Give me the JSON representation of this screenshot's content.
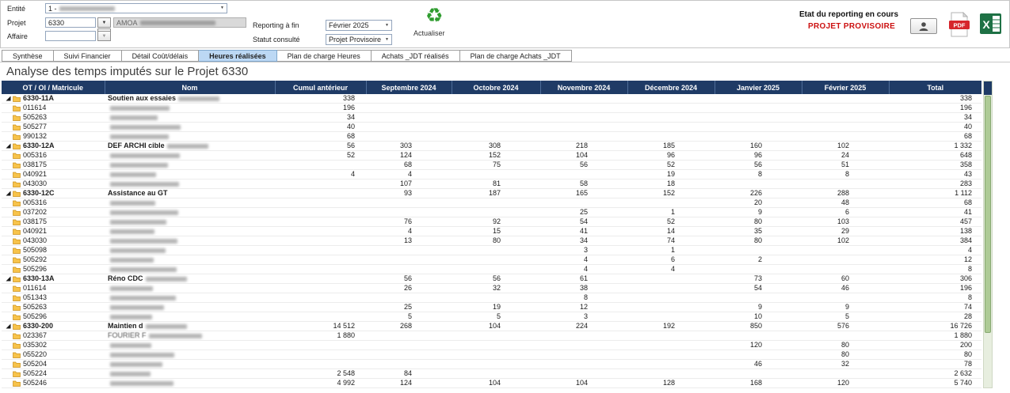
{
  "glyphs": {
    "caret": "▼",
    "dots": "…",
    "recycle": "♻"
  },
  "icons": {
    "refresh": "recycle-arrows",
    "user": "person-silhouette",
    "pdf": "pdf-file",
    "excel": "excel-file",
    "folder": "folder",
    "expand": "expanded-node-triangle",
    "caret": "dropdown-caret"
  },
  "toolbar": {
    "entite_label": "Entité",
    "entite_value": "1 -",
    "projet_label": "Projet",
    "projet_value": "6330",
    "projet_desc_prefix": "AMOA",
    "affaire_label": "Affaire",
    "affaire_value": "",
    "reporting_label": "Reporting à fin",
    "reporting_value": "Février 2025",
    "statut_label": "Statut consulté",
    "statut_value": "Projet Provisoire",
    "refresh_label": "Actualiser",
    "status_heading": "Etat du reporting en cours",
    "status_value": "PROJET PROVISOIRE"
  },
  "tabs": [
    {
      "label": "Synthèse",
      "active": false
    },
    {
      "label": "Suivi Financier",
      "active": false
    },
    {
      "label": "Détail Coût/délais",
      "active": false
    },
    {
      "label": "Heures réalisées",
      "active": true
    },
    {
      "label": "Plan de charge Heures",
      "active": false
    },
    {
      "label": "Achats _JDT réalisés",
      "active": false
    },
    {
      "label": "Plan de charge Achats _JDT",
      "active": false
    }
  ],
  "page_title": "Analyse des temps imputés sur le Projet 6330",
  "table": {
    "columns": [
      "OT / OI / Matricule",
      "Nom",
      "Cumul antérieur",
      "Septembre 2024",
      "Octobre 2024",
      "Novembre 2024",
      "Décembre 2024",
      "Janvier 2025",
      "Février 2025",
      "Total"
    ],
    "rows": [
      {
        "group": true,
        "code": "6330-11A",
        "name": "Soutien aux essaies",
        "redacted": true,
        "v": [
          "338",
          "",
          "",
          "",
          "",
          "",
          "",
          "338"
        ]
      },
      {
        "group": false,
        "code": "011614",
        "name": "",
        "redacted": true,
        "v": [
          "196",
          "",
          "",
          "",
          "",
          "",
          "",
          "196"
        ]
      },
      {
        "group": false,
        "code": "505263",
        "name": "",
        "redacted": true,
        "v": [
          "34",
          "",
          "",
          "",
          "",
          "",
          "",
          "34"
        ]
      },
      {
        "group": false,
        "code": "505277",
        "name": "",
        "redacted": true,
        "v": [
          "40",
          "",
          "",
          "",
          "",
          "",
          "",
          "40"
        ]
      },
      {
        "group": false,
        "code": "990132",
        "name": "",
        "redacted": true,
        "v": [
          "68",
          "",
          "",
          "",
          "",
          "",
          "",
          "68"
        ]
      },
      {
        "group": true,
        "code": "6330-12A",
        "name": "DEF ARCHI cible",
        "redacted": true,
        "v": [
          "56",
          "303",
          "308",
          "218",
          "185",
          "160",
          "102",
          "1 332"
        ]
      },
      {
        "group": false,
        "code": "005316",
        "name": "",
        "redacted": true,
        "v": [
          "52",
          "124",
          "152",
          "104",
          "96",
          "96",
          "24",
          "648"
        ]
      },
      {
        "group": false,
        "code": "038175",
        "name": "",
        "redacted": true,
        "v": [
          "",
          "68",
          "75",
          "56",
          "52",
          "56",
          "51",
          "358"
        ]
      },
      {
        "group": false,
        "code": "040921",
        "name": "",
        "redacted": true,
        "v": [
          "4",
          "4",
          "",
          "",
          "19",
          "8",
          "8",
          "43"
        ]
      },
      {
        "group": false,
        "code": "043030",
        "name": "",
        "redacted": true,
        "v": [
          "",
          "107",
          "81",
          "58",
          "18",
          "",
          "",
          "283"
        ]
      },
      {
        "group": true,
        "code": "6330-12C",
        "name": "Assistance au GT",
        "redacted": false,
        "v": [
          "",
          "93",
          "187",
          "165",
          "152",
          "226",
          "288",
          "1 112"
        ]
      },
      {
        "group": false,
        "code": "005316",
        "name": "",
        "redacted": true,
        "v": [
          "",
          "",
          "",
          "",
          "",
          "20",
          "48",
          "68"
        ]
      },
      {
        "group": false,
        "code": "037202",
        "name": "",
        "redacted": true,
        "v": [
          "",
          "",
          "",
          "25",
          "1",
          "9",
          "6",
          "41"
        ]
      },
      {
        "group": false,
        "code": "038175",
        "name": "",
        "redacted": true,
        "v": [
          "",
          "76",
          "92",
          "54",
          "52",
          "80",
          "103",
          "457"
        ]
      },
      {
        "group": false,
        "code": "040921",
        "name": "",
        "redacted": true,
        "v": [
          "",
          "4",
          "15",
          "41",
          "14",
          "35",
          "29",
          "138"
        ]
      },
      {
        "group": false,
        "code": "043030",
        "name": "",
        "redacted": true,
        "v": [
          "",
          "13",
          "80",
          "34",
          "74",
          "80",
          "102",
          "384"
        ]
      },
      {
        "group": false,
        "code": "505098",
        "name": "",
        "redacted": true,
        "v": [
          "",
          "",
          "",
          "3",
          "1",
          "",
          "",
          "4"
        ]
      },
      {
        "group": false,
        "code": "505292",
        "name": "",
        "redacted": true,
        "v": [
          "",
          "",
          "",
          "4",
          "6",
          "2",
          "",
          "12"
        ]
      },
      {
        "group": false,
        "code": "505296",
        "name": "",
        "redacted": true,
        "v": [
          "",
          "",
          "",
          "4",
          "4",
          "",
          "",
          "8"
        ]
      },
      {
        "group": true,
        "code": "6330-13A",
        "name": "Réno CDC",
        "redacted": true,
        "v": [
          "",
          "56",
          "56",
          "61",
          "",
          "73",
          "60",
          "306"
        ]
      },
      {
        "group": false,
        "code": "011614",
        "name": "",
        "redacted": true,
        "v": [
          "",
          "26",
          "32",
          "38",
          "",
          "54",
          "46",
          "196"
        ]
      },
      {
        "group": false,
        "code": "051343",
        "name": "",
        "redacted": true,
        "v": [
          "",
          "",
          "",
          "8",
          "",
          "",
          "",
          "8"
        ]
      },
      {
        "group": false,
        "code": "505263",
        "name": "",
        "redacted": true,
        "v": [
          "",
          "25",
          "19",
          "12",
          "",
          "9",
          "9",
          "74"
        ]
      },
      {
        "group": false,
        "code": "505296",
        "name": "",
        "redacted": true,
        "v": [
          "",
          "5",
          "5",
          "3",
          "",
          "10",
          "5",
          "28"
        ]
      },
      {
        "group": true,
        "code": "6330-200",
        "name": "Maintien d",
        "redacted": true,
        "v": [
          "14 512",
          "268",
          "104",
          "224",
          "192",
          "850",
          "576",
          "16 726"
        ]
      },
      {
        "group": false,
        "code": "023367",
        "name": "FOURIER F",
        "redacted": true,
        "v": [
          "1 880",
          "",
          "",
          "",
          "",
          "",
          "",
          "1 880"
        ]
      },
      {
        "group": false,
        "code": "035302",
        "name": "",
        "redacted": true,
        "v": [
          "",
          "",
          "",
          "",
          "",
          "120",
          "80",
          "200"
        ]
      },
      {
        "group": false,
        "code": "055220",
        "name": "",
        "redacted": true,
        "v": [
          "",
          "",
          "",
          "",
          "",
          "",
          "80",
          "80"
        ]
      },
      {
        "group": false,
        "code": "505204",
        "name": "",
        "redacted": true,
        "v": [
          "",
          "",
          "",
          "",
          "",
          "46",
          "32",
          "78"
        ]
      },
      {
        "group": false,
        "code": "505224",
        "name": "",
        "redacted": true,
        "v": [
          "2 548",
          "84",
          "",
          "",
          "",
          "",
          "",
          "2 632"
        ]
      },
      {
        "group": false,
        "code": "505246",
        "name": "",
        "redacted": true,
        "v": [
          "4 992",
          "124",
          "104",
          "104",
          "128",
          "168",
          "120",
          "5 740"
        ]
      }
    ]
  },
  "colors": {
    "table_header_bg": "#1F3B66",
    "active_tab_bg": "#BCD8F4",
    "alert_red": "#CC1111",
    "refresh_green": "#2E9C2E",
    "folder_yellow": "#F7C34B",
    "scrollbar_green": "#AECB96"
  }
}
